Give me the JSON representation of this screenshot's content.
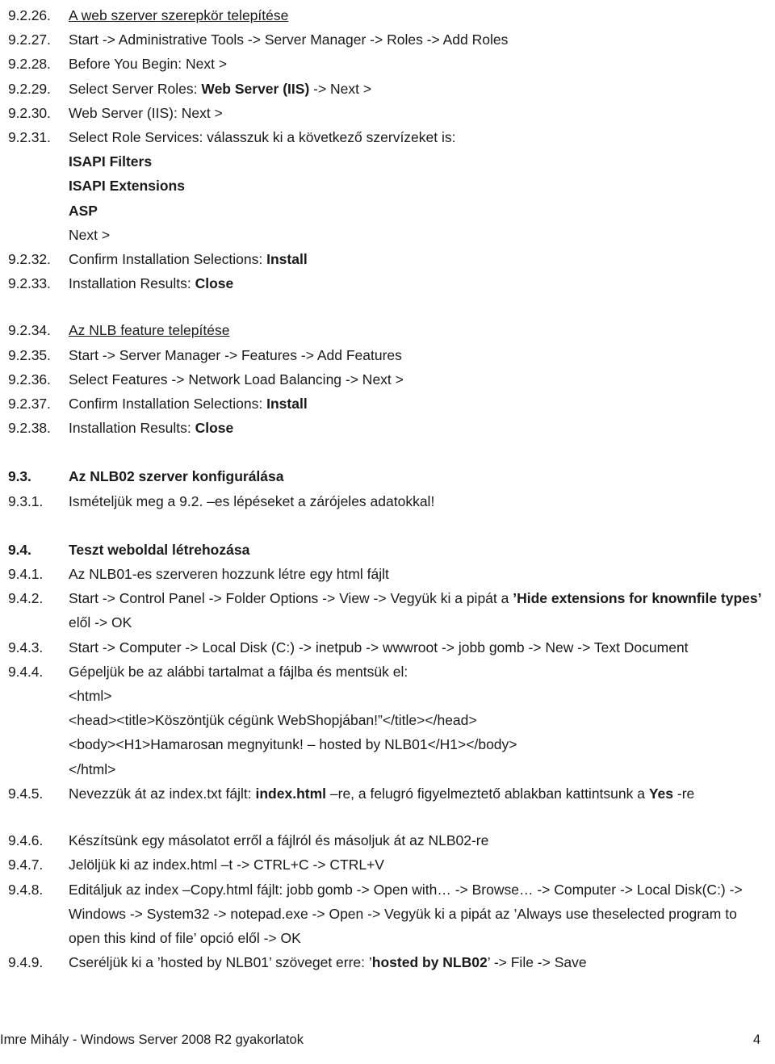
{
  "document": {
    "footer_left": "Imre Mihály - Windows Server 2008 R2 gyakorlatok",
    "footer_page": "4"
  },
  "items": [
    {
      "id": "i-9-2-26",
      "number": "9.2.26.",
      "kind": "step-underlined",
      "text": "A web szerver szerepkör telepítése"
    },
    {
      "id": "i-9-2-27",
      "number": "9.2.27.",
      "kind": "step",
      "text": "Start -> Administrative Tools -> Server Manager -> Roles -> Add Roles"
    },
    {
      "id": "i-9-2-28",
      "number": "9.2.28.",
      "kind": "step",
      "text": "Before You Begin: Next >"
    },
    {
      "id": "i-9-2-29",
      "number": "9.2.29.",
      "kind": "step-mixed",
      "pre": "Select Server Roles: ",
      "bold": "Web Server (IIS)",
      "post": " -> Next >"
    },
    {
      "id": "i-9-2-30",
      "number": "9.2.30.",
      "kind": "step",
      "text": "Web Server (IIS): Next >"
    },
    {
      "id": "i-9-2-31",
      "number": "9.2.31.",
      "kind": "step",
      "text": "Select Role Services: válasszuk ki a következő szervízeket is:"
    },
    {
      "id": "i-9-2-31-a",
      "number": "",
      "kind": "sub-bold",
      "text": "ISAPI Filters"
    },
    {
      "id": "i-9-2-31-b",
      "number": "",
      "kind": "sub-bold",
      "text": "ISAPI Extensions"
    },
    {
      "id": "i-9-2-31-c",
      "number": "",
      "kind": "sub-bold",
      "text": "ASP"
    },
    {
      "id": "i-9-2-31-d",
      "number": "",
      "kind": "sub",
      "text": "Next >"
    },
    {
      "id": "i-9-2-32",
      "number": "9.2.32.",
      "kind": "step-mixed",
      "pre": "Confirm Installation Selections: ",
      "bold": "Install",
      "post": ""
    },
    {
      "id": "i-9-2-33",
      "number": "9.2.33.",
      "kind": "step-mixed",
      "pre": "Installation Results: ",
      "bold": "Close",
      "post": ""
    },
    {
      "id": "i-9-2-34",
      "number": "9.2.34.",
      "kind": "step-underlined",
      "text": "Az NLB feature telepítése",
      "gap_before": "md"
    },
    {
      "id": "i-9-2-35",
      "number": "9.2.35.",
      "kind": "step",
      "text": "Start -> Server Manager -> Features -> Add Features"
    },
    {
      "id": "i-9-2-36",
      "number": "9.2.36.",
      "kind": "step",
      "text": "Select Features -> Network Load Balancing -> Next >"
    },
    {
      "id": "i-9-2-37",
      "number": "9.2.37.",
      "kind": "step-mixed",
      "pre": "Confirm Installation Selections: ",
      "bold": "Install",
      "post": ""
    },
    {
      "id": "i-9-2-38",
      "number": "9.2.38.",
      "kind": "step-mixed",
      "pre": "Installation Results: ",
      "bold": "Close",
      "post": ""
    },
    {
      "id": "i-9-3",
      "number": "9.3.",
      "kind": "section",
      "text": "Az NLB02 szerver konfigurálása",
      "gap_before": "lg"
    },
    {
      "id": "i-9-3-1",
      "number": "9.3.1.",
      "kind": "step",
      "text": "Ismételjük meg a 9.2. –es lépéseket a zárójeles adatokkal!"
    },
    {
      "id": "i-9-4",
      "number": "9.4.",
      "kind": "section",
      "text": "Teszt weboldal létrehozása",
      "gap_before": "lg"
    },
    {
      "id": "i-9-4-1",
      "number": "9.4.1.",
      "kind": "step",
      "text": "Az NLB01-es szerveren hozzunk létre egy html fájlt"
    },
    {
      "id": "i-9-4-2",
      "number": "9.4.2.",
      "kind": "step-wrap",
      "line1_pre": "Start -> Control Panel -> Folder Options -> View -> Vegyük ki a pipát a ",
      "line1_bold": "’Hide extensions for known",
      "line2_bold": "file types’",
      "line2_post": " elől -> OK"
    },
    {
      "id": "i-9-4-3",
      "number": "9.4.3.",
      "kind": "step",
      "text": "Start -> Computer -> Local Disk (C:) -> inetpub -> wwwroot -> jobb gomb -> New -> Text Document"
    },
    {
      "id": "i-9-4-4",
      "number": "9.4.4.",
      "kind": "step",
      "text": "Gépeljük be az alábbi tartalmat a fájlba és mentsük el:"
    },
    {
      "id": "i-9-4-4-a",
      "number": "",
      "kind": "sub",
      "text": "<html>"
    },
    {
      "id": "i-9-4-4-b",
      "number": "",
      "kind": "sub",
      "text": "<head><title>Köszöntjük cégünk WebShopjában!”</title></head>"
    },
    {
      "id": "i-9-4-4-c",
      "number": "",
      "kind": "sub",
      "text": "<body><H1>Hamarosan megnyitunk! – hosted by NLB01</H1></body>"
    },
    {
      "id": "i-9-4-4-d",
      "number": "",
      "kind": "sub",
      "text": "</html>"
    },
    {
      "id": "i-9-4-5",
      "number": "9.4.5.",
      "kind": "step-mixed3",
      "pre": "Nevezzük át az index.txt fájlt: ",
      "bold": "index.html",
      "mid": " –re, a felugró figyelmeztető ablakban kattintsunk a ",
      "bold2": "Yes",
      "post": " -re"
    },
    {
      "id": "i-9-4-6",
      "number": "9.4.6.",
      "kind": "step",
      "text": "Készítsünk egy másolatot erről a fájlról és másoljuk át az NLB02-re",
      "gap_before": "md"
    },
    {
      "id": "i-9-4-7",
      "number": "9.4.7.",
      "kind": "step",
      "text": "Jelöljük ki az index.html –t -> CTRL+C -> CTRL+V"
    },
    {
      "id": "i-9-4-8",
      "number": "9.4.8.",
      "kind": "step-wrap3",
      "line1": "Editáljuk az index –Copy.html fájlt: jobb gomb -> Open with… -> Browse… -> Computer -> Local Disk",
      "line2": "(C:) -> Windows -> System32 -> notepad.exe -> Open -> Vegyük ki a pipát az ’Always use the",
      "line3": "selected program to open this kind of file’ opció elől -> OK"
    },
    {
      "id": "i-9-4-9",
      "number": "9.4.9.",
      "kind": "step-mixed",
      "pre": "Cseréljük ki a ’hosted by NLB01’ szöveget erre: ’",
      "bold": "hosted by NLB02",
      "post": "’ -> File -> Save"
    }
  ]
}
